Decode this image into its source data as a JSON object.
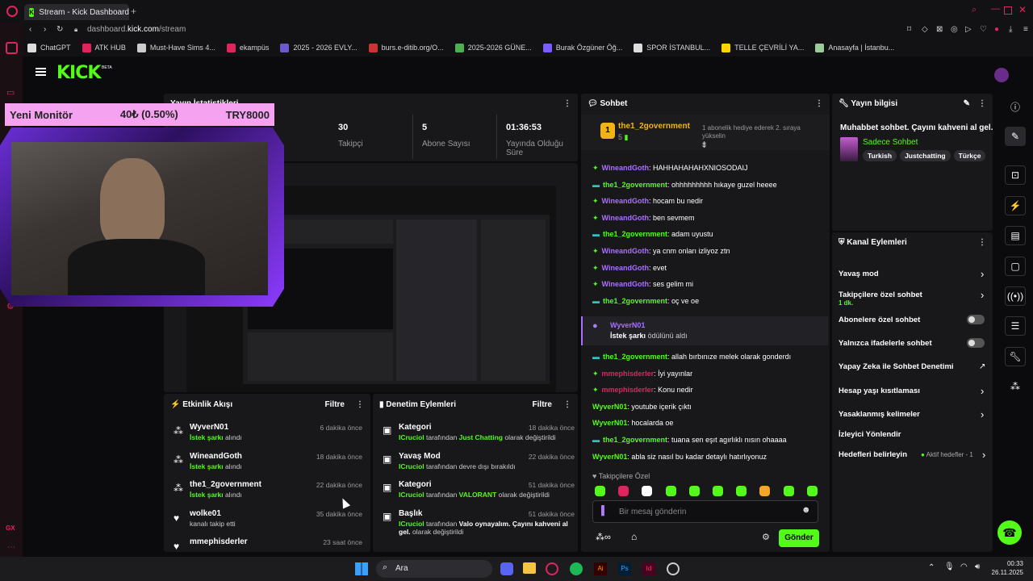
{
  "browser": {
    "tab_title": "Stream - Kick Dashboard",
    "url_prefix": "dashboard.",
    "url_domain": "kick.com",
    "url_path": "/stream"
  },
  "bookmarks": [
    "ChatGPT",
    "ATK HUB",
    "Must-Have Sims 4...",
    "ekampüs",
    "2025 - 2026 EVLY...",
    "burs.e-ditib.org/O...",
    "2025-2026 GÜNE...",
    "Burak Özgüner Öğ...",
    "SPOR İSTANBUL...",
    "TELLE ÇEVRİLİ YA...",
    "Anasayfa | İstanbu..."
  ],
  "kick": {
    "logo": "KICK",
    "beta": "BETA"
  },
  "stats": {
    "title": "Yayın İstatistikleri",
    "followers_value": "30",
    "followers_label": "Takipçi",
    "subs_value": "5",
    "subs_label": "Abone Sayısı",
    "time_value": "01:36:53",
    "time_label": "Yayında Olduğu Süre"
  },
  "overlay": {
    "monitor_label": "Yeni Monitör",
    "monitor_pct": "40₺ (0.50%)",
    "monitor_goal": "TRY8000"
  },
  "chat": {
    "title": "Sohbet",
    "pinned_user": "the1_2government",
    "pinned_count": "5",
    "pinned_msg": "1 abonelik hediye ederek 2. sıraya yükselin",
    "messages": [
      {
        "user": "WineandGoth",
        "text": "HAHHAHAHAHXNIOSODAIJ",
        "color": "#a970ff",
        "badge": "diamond"
      },
      {
        "user": "the1_2government",
        "text": "ohhhhhhhhh hıkaye guzel heeee",
        "color": "#53fc18",
        "badge": "gift"
      },
      {
        "user": "WineandGoth",
        "text": "hocam bu nedir",
        "color": "#a970ff",
        "badge": "diamond"
      },
      {
        "user": "WineandGoth",
        "text": "ben sevmem",
        "color": "#a970ff",
        "badge": "diamond"
      },
      {
        "user": "the1_2government",
        "text": "adam uyustu",
        "color": "#53fc18",
        "badge": "gift"
      },
      {
        "user": "WineandGoth",
        "text": "ya cnm onları izliyoz ztn",
        "color": "#a970ff",
        "badge": "diamond"
      },
      {
        "user": "WineandGoth",
        "text": "evet",
        "color": "#a970ff",
        "badge": "diamond"
      },
      {
        "user": "WineandGoth",
        "text": "ses gelim mi",
        "color": "#a970ff",
        "badge": "diamond"
      },
      {
        "user": "the1_2government",
        "text": "oç ve oe",
        "color": "#53fc18",
        "badge": "gift"
      }
    ],
    "reward_user": "WyverN01",
    "reward_prefix": "İstek şarkı",
    "reward_suffix": "ödülünü aldı",
    "messages2": [
      {
        "user": "the1_2government",
        "text": "allah bırbınıze melek olarak gonderdı",
        "color": "#53fc18",
        "badge": "gift"
      },
      {
        "user": "mmephisderler",
        "text": "İyi yayınlar",
        "color": "#e0245e",
        "badge": "diamond"
      },
      {
        "user": "mmephisderler",
        "text": "Konu nedir",
        "color": "#e0245e",
        "badge": "diamond"
      },
      {
        "user": "WyverN01",
        "text": "youtube içerik çıktı",
        "color": "#53fc18",
        "badge": ""
      },
      {
        "user": "WyverN01",
        "text": "hocalarda oe",
        "color": "#53fc18",
        "badge": ""
      },
      {
        "user": "the1_2government",
        "text": "tuana sen eşıt agırlıklı nısın ohaaaa",
        "color": "#53fc18",
        "badge": "gift"
      },
      {
        "user": "WyverN01",
        "text": "abla siz nasıl bu kadar detaylı hatırlıyonuz",
        "color": "#53fc18",
        "badge": ""
      }
    ],
    "followers_only": "Takipçilere Özel",
    "placeholder": "Bir mesaj gönderin",
    "send": "Gönder"
  },
  "info": {
    "title": "Yayın bilgisi",
    "stream_title": "Muhabbet sohbet. Çayını kahveni al gel.",
    "category": "Sadece Sohbet",
    "tags": [
      "Turkish",
      "Justchatting",
      "Türkçe"
    ]
  },
  "actions": {
    "title": "Kanal Eylemleri",
    "items": [
      {
        "label": "Yavaş mod",
        "sub": "",
        "type": "chevron"
      },
      {
        "label": "Takipçilere özel sohbet",
        "sub": "1 dk.",
        "type": "chevron"
      },
      {
        "label": "Abonelere özel sohbet",
        "sub": "",
        "type": "toggle"
      },
      {
        "label": "Yalnızca ifadelerle sohbet",
        "sub": "",
        "type": "toggle"
      },
      {
        "label": "Yapay Zeka ile Sohbet Denetimi",
        "sub": "",
        "type": "external"
      },
      {
        "label": "Hesap yaşı kısıtlaması",
        "sub": "",
        "type": "chevron"
      },
      {
        "label": "Yasaklanmış kelimeler",
        "sub": "",
        "type": "chevron"
      },
      {
        "label": "İzleyici Yönlendir",
        "sub": "",
        "type": "none"
      },
      {
        "label": "Hedefleri belirleyin",
        "sub": "",
        "type": "goals",
        "extra": "Aktif hedefler - 1"
      }
    ]
  },
  "feed": {
    "title": "Etkinlik Akışı",
    "filter": "Filtre",
    "items": [
      {
        "user": "WyverN01",
        "highlight": "İstek şarkı",
        "rest": " alındı",
        "time": "6 dakika önce",
        "icon": "reward"
      },
      {
        "user": "WineandGoth",
        "highlight": "İstek şarkı",
        "rest": " alındı",
        "time": "18 dakika önce",
        "icon": "reward"
      },
      {
        "user": "the1_2government",
        "highlight": "İstek şarkı",
        "rest": " alındı",
        "time": "22 dakika önce",
        "icon": "reward"
      },
      {
        "user": "wolke01",
        "highlight": "",
        "rest": "kanalı takip etti",
        "time": "35 dakika önce",
        "icon": "heart"
      },
      {
        "user": "mmephisderler",
        "highlight": "",
        "rest": "",
        "time": "23 saat önce",
        "icon": "heart"
      }
    ]
  },
  "mod": {
    "title": "Denetim Eylemleri",
    "filter": "Filtre",
    "items": [
      {
        "action": "Kategori",
        "by": "ICruciol",
        "mid": " tarafından ",
        "value": "Just Chatting",
        "tail": " olarak değiştirildi",
        "time": "18 dakika önce"
      },
      {
        "action": "Yavaş Mod",
        "by": "ICruciol",
        "mid": " tarafından devre dışı bırakıldı",
        "value": "",
        "tail": "",
        "time": "22 dakika önce"
      },
      {
        "action": "Kategori",
        "by": "ICruciol",
        "mid": " tarafından ",
        "value": "VALORANT",
        "tail": " olarak değiştirildi",
        "time": "51 dakika önce"
      },
      {
        "action": "Başlık",
        "by": "ICruciol",
        "mid": " tarafından ",
        "value": "Valo oynayalım. Çayını kahveni al gel.",
        "tail": " olarak değiştirildi",
        "time": "51 dakika önce"
      }
    ]
  },
  "taskbar": {
    "search": "Ara",
    "time": "00:33",
    "date": "26.11.2025"
  },
  "colors": {
    "kick_green": "#53fc18",
    "panel": "#18181b",
    "purple": "#a970ff",
    "overlay_pink": "#f5a3f0"
  }
}
